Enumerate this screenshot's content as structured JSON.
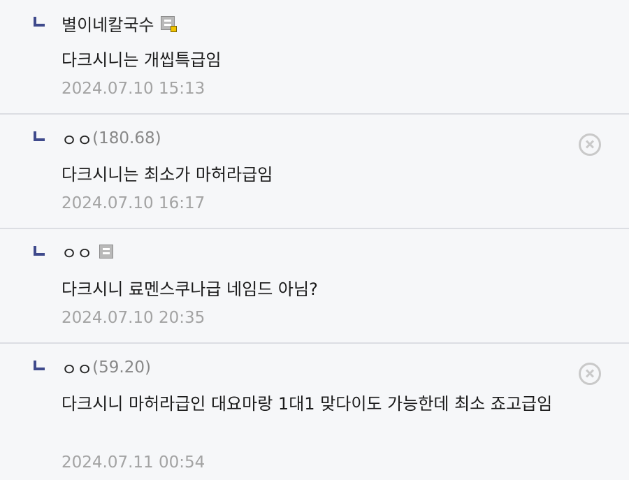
{
  "comments": [
    {
      "nickname": "별이네칼국수",
      "ip": "",
      "gallog_icon": "gallog-icon-with-badge",
      "text": "다크시니는 개씹특급임",
      "date": "2024.07.10 15:13",
      "deletable": false
    },
    {
      "nickname": "ㅇㅇ",
      "ip": "(180.68)",
      "text": "다크시니는 최소가 마허라급임",
      "date": "2024.07.10 16:17",
      "deletable": true
    },
    {
      "nickname": "ㅇㅇ",
      "ip": "",
      "gallog_icon": "gallog-icon",
      "text": "다크시니 료멘스쿠나급 네임드 아님?",
      "date": "2024.07.10 20:35",
      "deletable": false
    },
    {
      "nickname": "ㅇㅇ",
      "ip": "(59.20)",
      "text": "다크시니 마허라급인 대요마랑 1대1 맞다이도 가능한데 최소 죠고급임",
      "date": "2024.07.11 00:54",
      "deletable": true
    }
  ],
  "colors": {
    "background": "#f6f7f9",
    "reply_arrow": "#3f4a8c",
    "date_text": "#a3a3a3",
    "ip_text": "#888888",
    "divider": "#dcdee3"
  },
  "icons": {
    "reply": "reply-arrow-icon",
    "delete": "delete-circle-x-icon"
  }
}
